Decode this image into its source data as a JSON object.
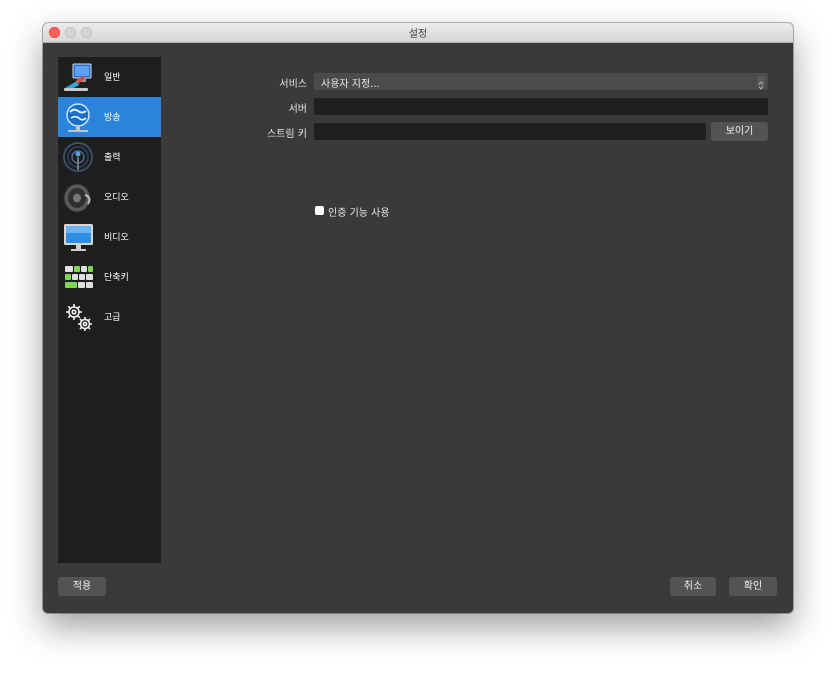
{
  "window": {
    "title": "설정"
  },
  "sidebar": {
    "items": [
      {
        "label": "일반",
        "icon": "general-icon"
      },
      {
        "label": "방송",
        "icon": "stream-globe-icon",
        "active": true
      },
      {
        "label": "출력",
        "icon": "output-icon"
      },
      {
        "label": "오디오",
        "icon": "audio-speaker-icon"
      },
      {
        "label": "비디오",
        "icon": "video-monitor-icon"
      },
      {
        "label": "단축키",
        "icon": "keyboard-icon"
      },
      {
        "label": "고급",
        "icon": "gears-icon"
      }
    ]
  },
  "form": {
    "service_label": "서비스",
    "service_value": "사용자 지정...",
    "server_label": "서버",
    "server_value": "",
    "stream_key_label": "스트림 키",
    "stream_key_value": "",
    "show_button": "보이기",
    "auth_label": "인증 기능 사용",
    "auth_checked": false
  },
  "footer": {
    "apply": "적용",
    "cancel": "취소",
    "ok": "확인"
  },
  "colors": {
    "window_bg": "#3a3a3a",
    "sidebar_bg": "#1e1e1e",
    "active_item": "#2b84dc",
    "input_bg": "#1f1f1f",
    "button_bg": "#535353"
  }
}
